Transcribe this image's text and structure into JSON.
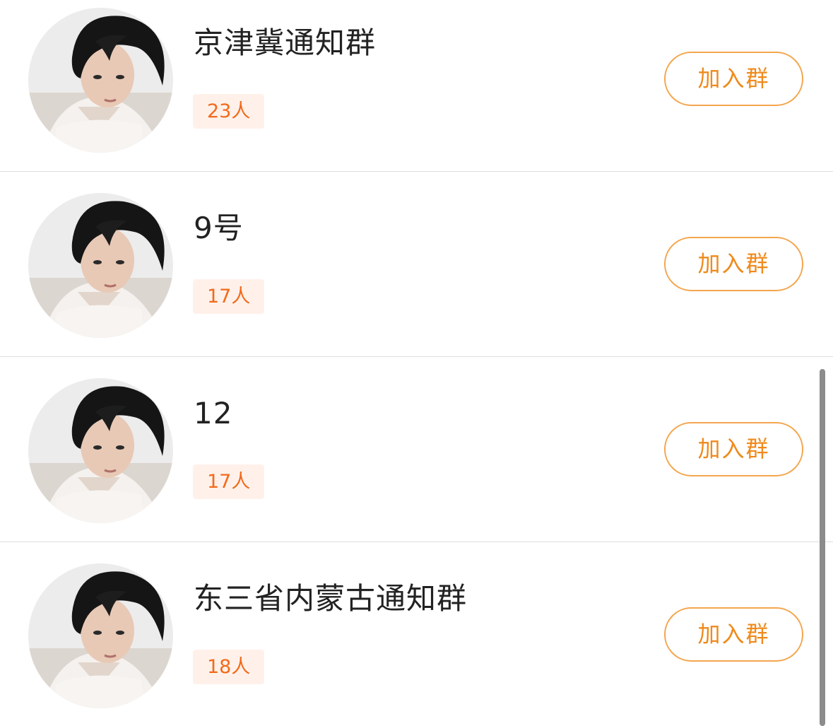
{
  "groups": [
    {
      "name": "京津冀通知群",
      "members": "23人",
      "join_label": "加入群"
    },
    {
      "name": "9号",
      "members": "17人",
      "join_label": "加入群"
    },
    {
      "name": "12",
      "members": "17人",
      "join_label": "加入群"
    },
    {
      "name": "东三省内蒙古通知群",
      "members": "18人",
      "join_label": "加入群"
    }
  ],
  "colors": {
    "accent": "#ef8a1c",
    "badge_text": "#f26a1b",
    "badge_bg": "#fff1ea",
    "divider": "#dedede"
  }
}
